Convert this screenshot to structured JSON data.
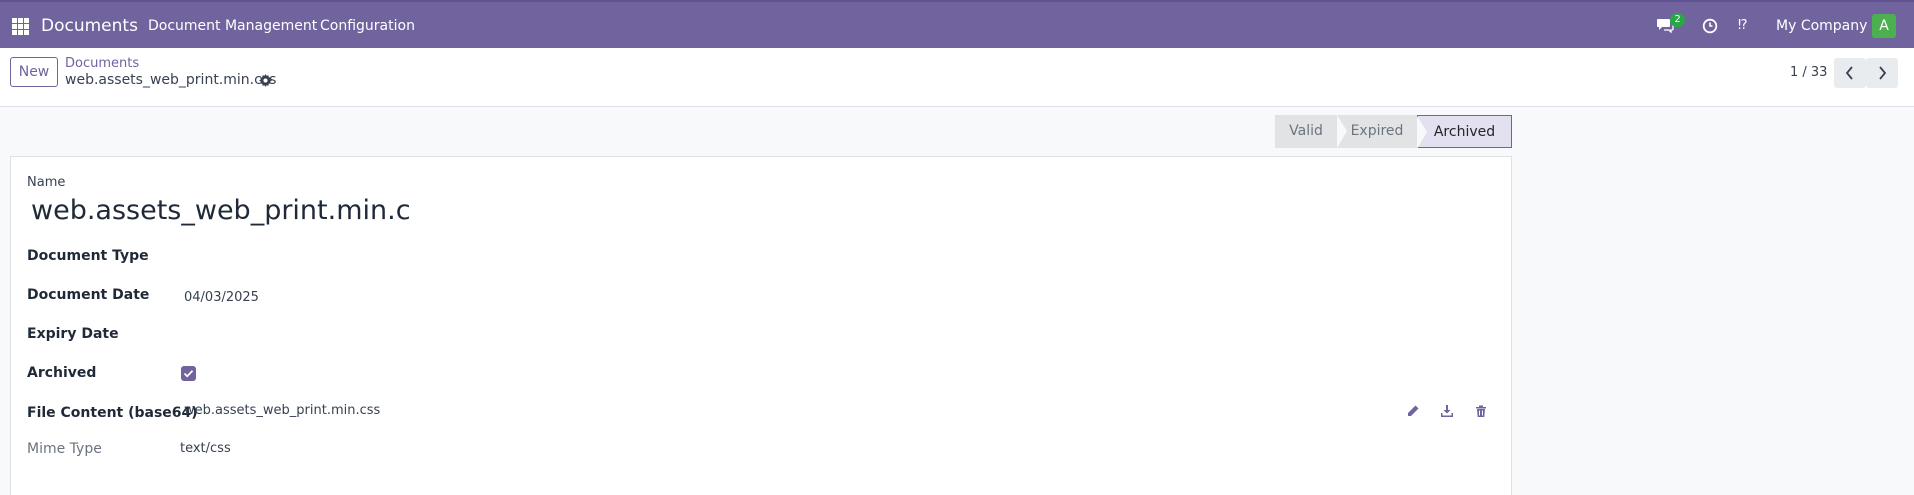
{
  "topbar": {
    "app_name": "Documents",
    "menu": [
      "Document Management",
      "Configuration"
    ],
    "messages_badge": "2",
    "debug_label": "⁉",
    "company": "My Company",
    "avatar_letter": "A",
    "brand_color": "#71639e"
  },
  "control_panel": {
    "new_label": "New",
    "breadcrumb_parent": "Documents",
    "breadcrumb_current": "web.assets_web_print.min.css",
    "pager": "1 / 33"
  },
  "status": {
    "stages": [
      "Valid",
      "Expired",
      "Archived"
    ],
    "active": "Archived"
  },
  "form": {
    "name_label": "Name",
    "name_value": "web.assets_web_print.min.css",
    "document_type_label": "Document Type",
    "document_date_label": "Document Date",
    "document_date_value": "04/03/2025",
    "expiry_date_label": "Expiry Date",
    "archived_label": "Archived",
    "archived_checked": true,
    "file_content_label": "File Content (base64)",
    "file_content_value": "web.assets_web_print.min.css",
    "mime_type_label": "Mime Type",
    "mime_type_value": "text/css",
    "file_actions": [
      "pencil-icon",
      "download-icon",
      "trash-icon"
    ]
  }
}
